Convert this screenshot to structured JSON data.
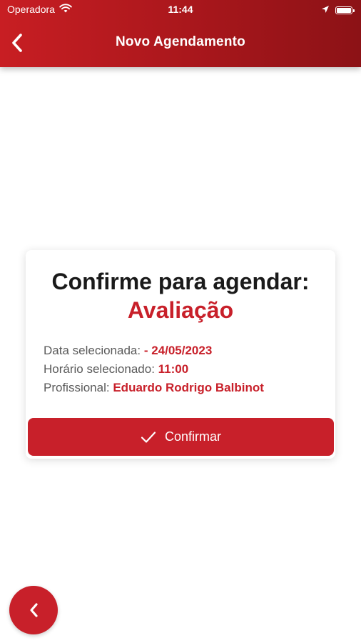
{
  "status_bar": {
    "carrier": "Operadora",
    "time": "11:44"
  },
  "header": {
    "title": "Novo Agendamento"
  },
  "confirm_card": {
    "title": "Confirme para agendar:",
    "service": "Avaliação",
    "date_label": "Data selecionada:",
    "date_value": "- 24/05/2023",
    "time_label": "Horário selecionado:",
    "time_value": "11:00",
    "professional_label": "Profissional:",
    "professional_value": "Eduardo Rodrigo Balbinot",
    "confirm_label": "Confirmar"
  },
  "colors": {
    "brand": "#c8202a",
    "header_dark": "#8c1216"
  }
}
